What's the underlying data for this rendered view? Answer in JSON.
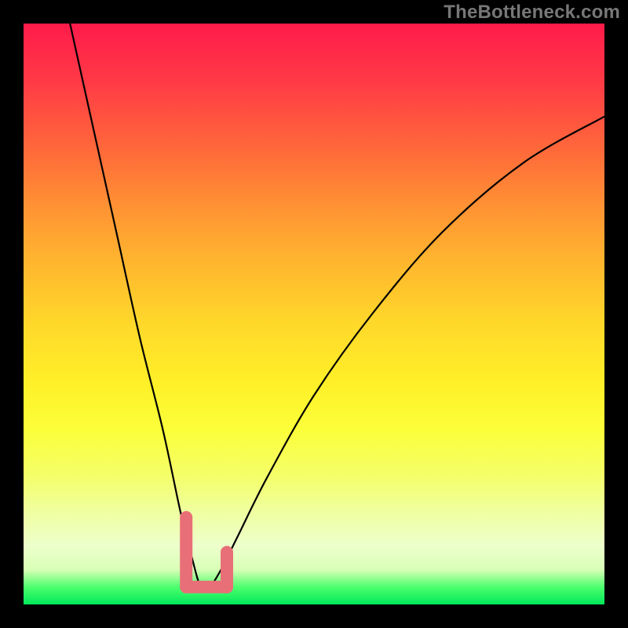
{
  "attribution": "TheBottleneck.com",
  "chart_data": {
    "type": "line",
    "title": "",
    "xlabel": "",
    "ylabel": "",
    "xlim": [
      0,
      100
    ],
    "ylim": [
      0,
      100
    ],
    "grid": false,
    "legend": false,
    "background": "rainbow_gradient_vertical",
    "series": [
      {
        "name": "bottleneck-curve",
        "x": [
          8,
          12,
          16,
          20,
          24,
          27,
          29,
          30.5,
          32,
          34,
          37,
          42,
          50,
          60,
          72,
          86,
          100
        ],
        "y": [
          100,
          82,
          64,
          46,
          30,
          16,
          8,
          3,
          3,
          6,
          12,
          22,
          36,
          50,
          64,
          76,
          84
        ]
      }
    ],
    "minimum_point": {
      "x": 31,
      "y": 3
    },
    "accent_segment": {
      "description": "salmon highlight around curve minimum and short floor segment",
      "floor_x_range": [
        28,
        35
      ],
      "floor_y": 3,
      "left_wall_x": 28,
      "left_wall_y_range": [
        3,
        15
      ],
      "right_wall_x": 35,
      "right_wall_y_range": [
        3,
        9
      ]
    },
    "colors": {
      "curve": "#000000",
      "accent": "#e86f78",
      "frame": "#000000",
      "gradient_top": "#ff1b4a",
      "gradient_bottom": "#00e85a"
    }
  }
}
